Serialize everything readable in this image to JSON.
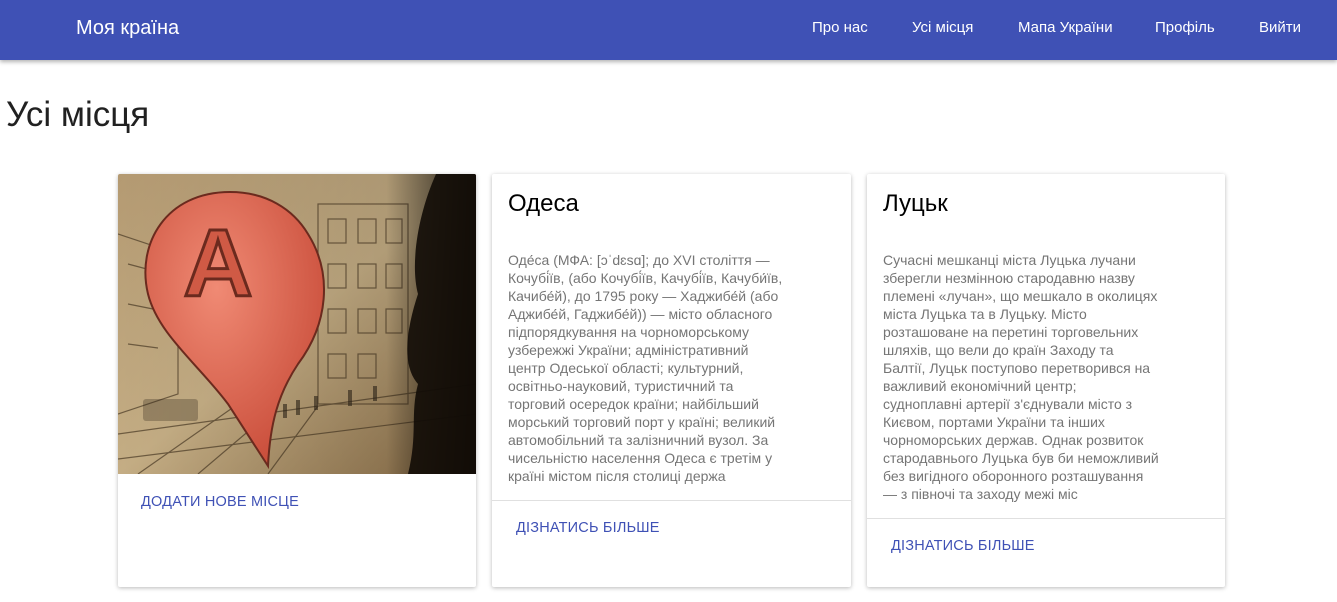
{
  "nav": {
    "brand": "Моя країна",
    "links": [
      "Про нас",
      "Усі місця",
      "Мапа України",
      "Профіль",
      "Вийти"
    ]
  },
  "page": {
    "title": "Усі місця"
  },
  "add_card": {
    "image_icon": "map-marker-a-icon",
    "image_letter": "A",
    "action": "ДОДАТИ НОВЕ МІСЦЕ"
  },
  "places": [
    {
      "title": "Одеса",
      "text": "Оде́са (МФА: [ɔˈdɛsɑ]; до XVI століття — Кочубі́їв, (або Кочубі́їв, Качубі́їв, Качуби́їв, Качибе́й), до 1795 року — Хаджибе́й (або Аджибе́й, Гаджибе́й)) — місто обласного підпорядкування на чорноморському узбережжі України; адміністративний центр Одеської області; культурний, освітньо-науковий, туристичний та торговий осередок країни; найбільший морський торговий порт у країні; великий автомобільний та залізничний вузол. За чисельністю населення Одеса є третім у країні містом після столиці держа",
      "action": "ДІЗНАТИСЬ БІЛЬШЕ"
    },
    {
      "title": "Луцьк",
      "text": "Сучасні мешканці міста Луцька лучани зберегли незмінною стародавню назву племені «лучан», що мешкало в околицях міста Луцька та в Луцьку. Місто розташоване на перетині торговельних шляхів, що вели до країн Заходу та Балтії, Луцьк поступово перетворився на важливий економічний центр; судноплавні артерії з'єднували місто з Києвом, портами України та інших чорноморських держав. Однак розвиток стародавнього Луцька був би неможливий без вигідного оборонного розташування — з півночі та заходу межі міс",
      "action": "ДІЗНАТИСЬ БІЛЬШЕ"
    }
  ],
  "colors": {
    "primary": "#3f51b5",
    "marker": "#e06a55"
  }
}
